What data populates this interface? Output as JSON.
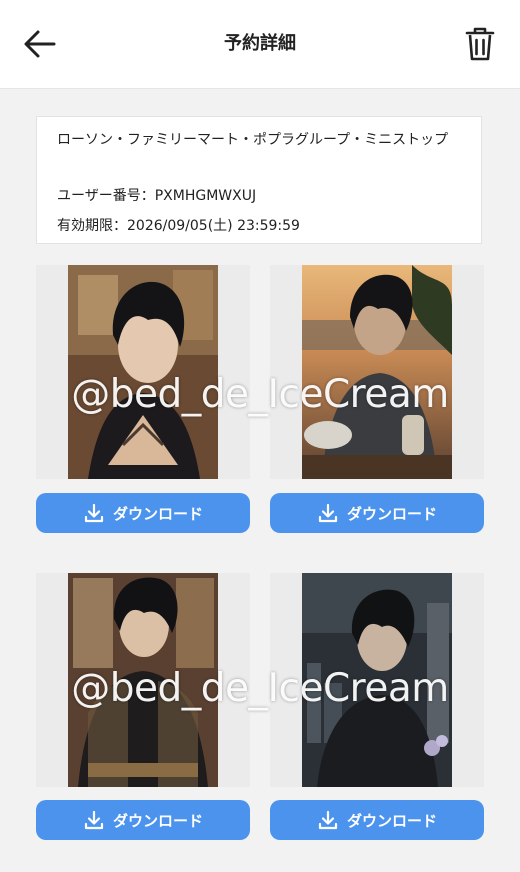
{
  "header": {
    "title": "予約詳細",
    "back_icon": "arrow-left-icon",
    "delete_icon": "trash-icon"
  },
  "info": {
    "stores": "ローソン・ファミリーマート・ポプラグループ・ミニストップ",
    "user_number_label": "ユーザー番号：",
    "user_number": "PXMHGMWXUJ",
    "expiry_label": "有効期限：",
    "expiry": "2026/09/05(土) 23:59:59"
  },
  "images": [
    {
      "download_label": "ダウンロード"
    },
    {
      "download_label": "ダウンロード"
    },
    {
      "download_label": "ダウンロード"
    },
    {
      "download_label": "ダウンロード"
    }
  ],
  "watermark": "@bed_de_IceCream",
  "colors": {
    "accent": "#4c93ee",
    "background": "#f2f2f2",
    "card": "#ffffff"
  }
}
